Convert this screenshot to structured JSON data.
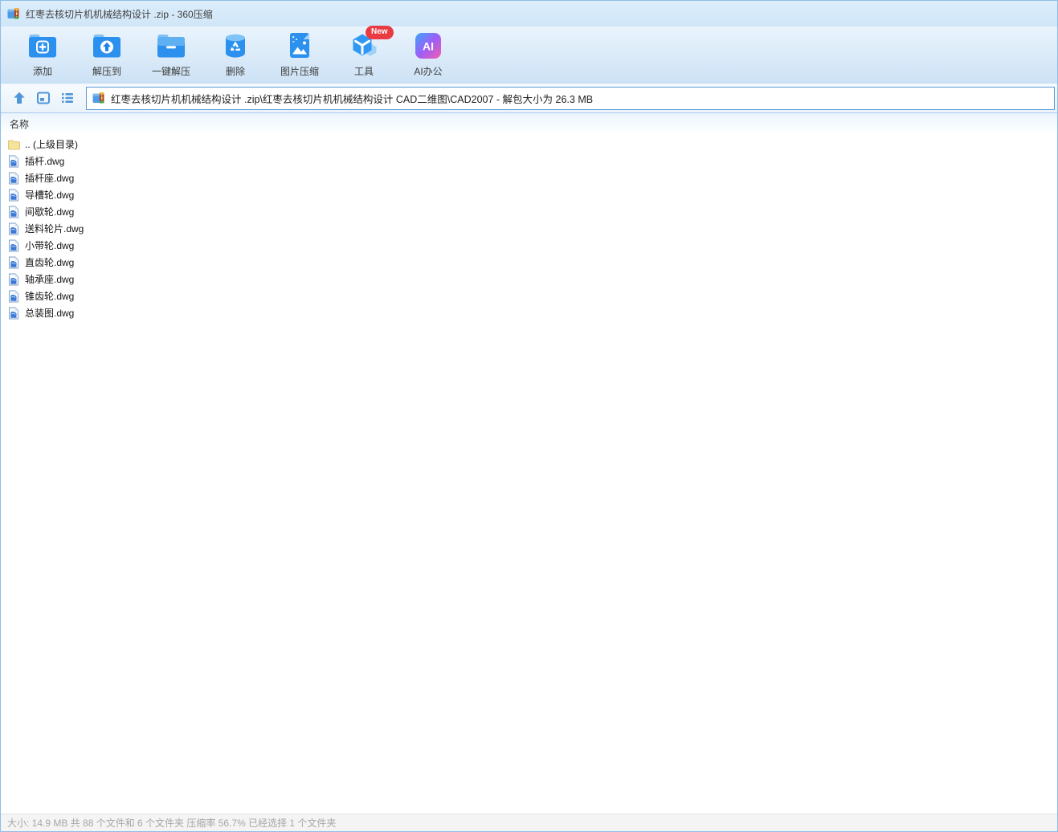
{
  "window": {
    "title": "红枣去核切片机机械结构设计 .zip - 360压缩"
  },
  "toolbar": {
    "items": [
      {
        "label": "添加",
        "icon": "add-folder-icon"
      },
      {
        "label": "解压到",
        "icon": "extract-to-folder-icon"
      },
      {
        "label": "一键解压",
        "icon": "one-click-extract-icon"
      },
      {
        "label": "删除",
        "icon": "delete-trash-icon"
      },
      {
        "label": "图片压缩",
        "icon": "image-compress-icon"
      },
      {
        "label": "工具",
        "icon": "tools-cube-icon",
        "badge": "New"
      },
      {
        "label": "AI办公",
        "icon": "ai-office-icon"
      }
    ]
  },
  "navbar": {
    "address": {
      "path": "红枣去核切片机机械结构设计 .zip\\红枣去核切片机机械结构设计 CAD二维图\\CAD2007 - 解包大小为 26.3 MB"
    }
  },
  "filelist": {
    "column_header": "名称",
    "items": [
      {
        "label": ".. (上级目录)",
        "icon": "parent-folder-icon"
      },
      {
        "label": "插杆.dwg",
        "icon": "dwg-file-icon"
      },
      {
        "label": "插杆座.dwg",
        "icon": "dwg-file-icon"
      },
      {
        "label": "导槽轮.dwg",
        "icon": "dwg-file-icon"
      },
      {
        "label": "间歇轮.dwg",
        "icon": "dwg-file-icon"
      },
      {
        "label": "送料轮片.dwg",
        "icon": "dwg-file-icon"
      },
      {
        "label": "小带轮.dwg",
        "icon": "dwg-file-icon"
      },
      {
        "label": "直齿轮.dwg",
        "icon": "dwg-file-icon"
      },
      {
        "label": "轴承座.dwg",
        "icon": "dwg-file-icon"
      },
      {
        "label": "锥齿轮.dwg",
        "icon": "dwg-file-icon"
      },
      {
        "label": "总装图.dwg",
        "icon": "dwg-file-icon"
      }
    ]
  },
  "statusbar": {
    "text": "大小: 14.9 MB 共 88 个文件和 6 个文件夹 压缩率 56.7% 已经选择 1 个文件夹"
  },
  "colors": {
    "accent_blue": "#2b90ee",
    "titlebar_bg": "#d5e9f9",
    "toolbar_bg_top": "#eaf4fd",
    "toolbar_bg_bottom": "#cde2f5",
    "address_border": "#5b9bd8",
    "badge_red": "#e93b41",
    "parent_folder_yellow": "#f7e49c",
    "status_text_gray": "#a6a6a6"
  }
}
